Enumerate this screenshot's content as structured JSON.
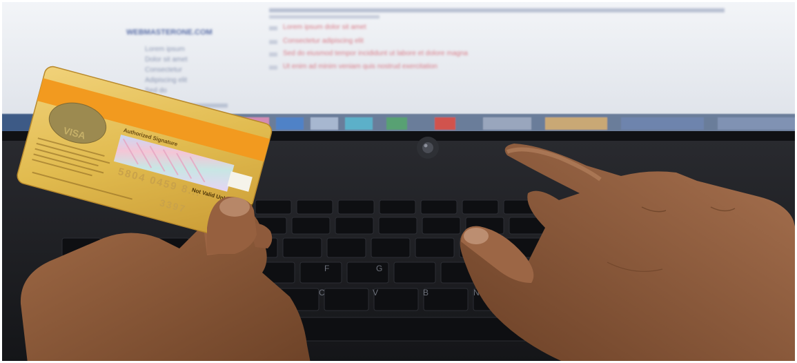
{
  "photo": {
    "subject": "hands holding a gold credit card and typing on a laptop keyboard"
  },
  "screen": {
    "heading": "WEBMASTERONE.COM",
    "sidebar_items": [
      "Lorem ipsum",
      "Dolor sit amet",
      "Consectetur",
      "Adipiscing elit",
      "Sed do"
    ],
    "links": [
      "Lorem ipsum dolor sit amet",
      "Consectetur adipiscing elit",
      "Sed do eiusmod tempor incididunt ut labore et dolore magna",
      "Ut enim ad minim veniam quis nostrud exercitation"
    ]
  },
  "card": {
    "signature_label": "Authorized Signature",
    "not_valid": "Not Valid Unless Signed",
    "number_partial": "5804 0459 8...",
    "hologram_text": "VISA",
    "code": "3397"
  },
  "keyboard": {
    "visible_keys": [
      "C",
      "V",
      "B",
      "N",
      "F",
      "G"
    ]
  },
  "colors": {
    "card_gold": "#e3bf55",
    "card_stripe": "#f29a1f",
    "laptop_body": "#1c1d21",
    "skin": "#8a5a3c",
    "screen_bg": "#e9ecf1"
  }
}
